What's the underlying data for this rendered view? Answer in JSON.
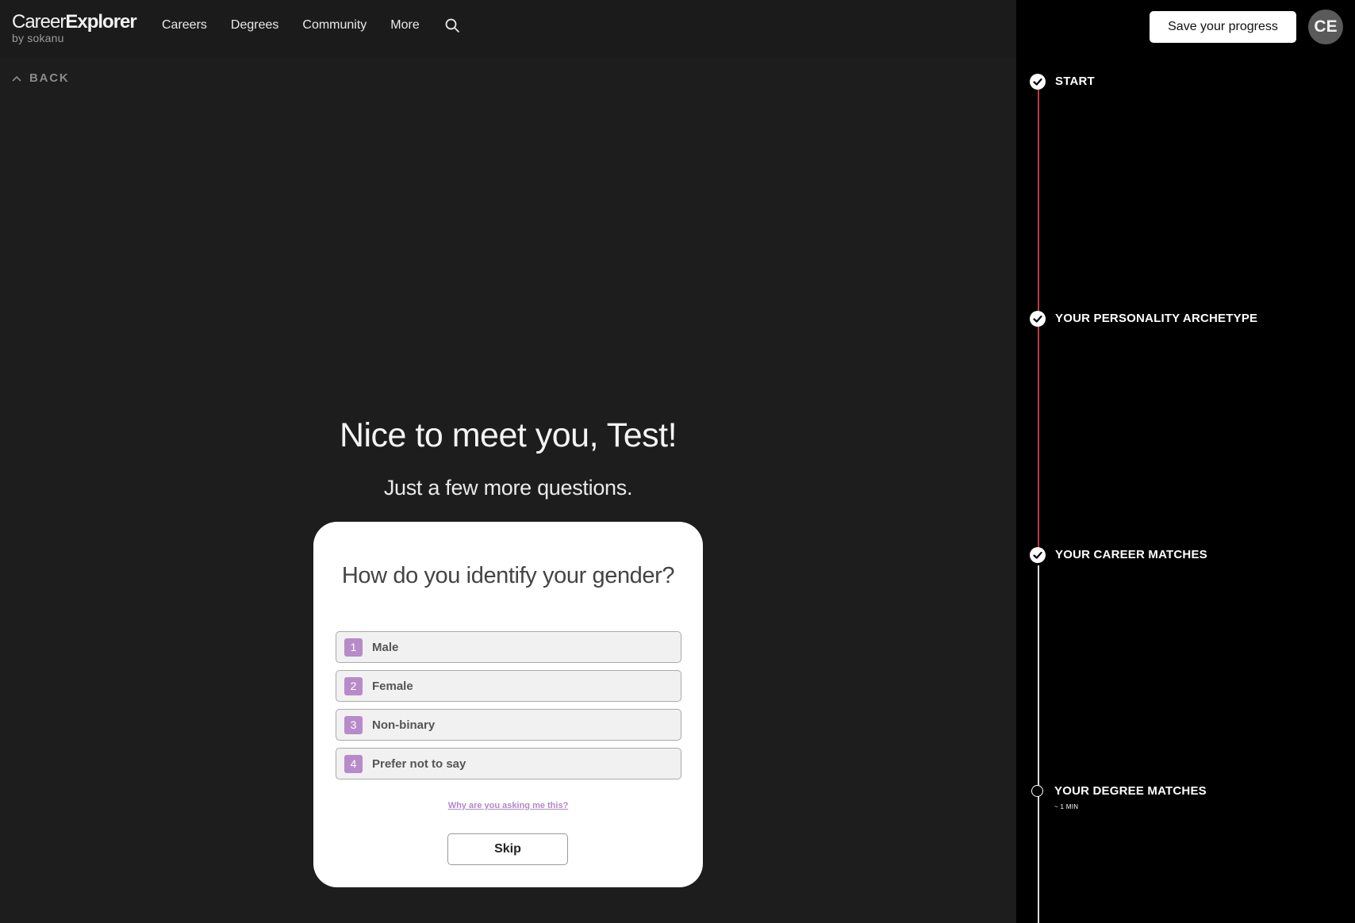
{
  "header": {
    "logo_main_light": "Career",
    "logo_main_bold": "Explorer",
    "logo_sub": "by sokanu",
    "nav": [
      "Careers",
      "Degrees",
      "Community",
      "More"
    ],
    "search_icon": "search-icon"
  },
  "back": {
    "label": "BACK",
    "icon": "chevron-up-icon"
  },
  "main": {
    "title": "Nice to meet you, Test!",
    "subtitle": "Just a few more questions."
  },
  "card": {
    "question": "How do you identify your gender?",
    "options": [
      {
        "num": "1",
        "label": "Male"
      },
      {
        "num": "2",
        "label": "Female"
      },
      {
        "num": "3",
        "label": "Non-binary"
      },
      {
        "num": "4",
        "label": "Prefer not to say"
      }
    ],
    "why_link": "Why are you asking me this?",
    "skip_label": "Skip"
  },
  "panel": {
    "save_label": "Save your progress",
    "avatar_initials": "CE",
    "steps": [
      {
        "label": "START",
        "status": "done"
      },
      {
        "label": "YOUR PERSONALITY ARCHETYPE",
        "status": "done"
      },
      {
        "label": "YOUR CAREER MATCHES",
        "status": "done"
      },
      {
        "label": "YOUR DEGREE MATCHES",
        "status": "pending",
        "sub": "~ 1 MIN"
      }
    ]
  },
  "colors": {
    "accent_purple": "#b78bc9",
    "progress_red": "#c0394a",
    "panel_bg": "#000000",
    "page_bg": "#1d1d1d"
  }
}
